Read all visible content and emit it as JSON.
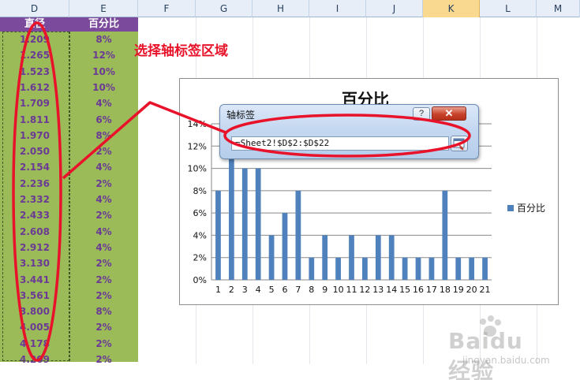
{
  "columns": [
    "D",
    "E",
    "F",
    "G",
    "H",
    "I",
    "J",
    "K",
    "L",
    "M"
  ],
  "selected_column": "K",
  "table": {
    "headers": [
      "直径",
      "百分比"
    ],
    "rows": [
      [
        "1.209",
        "8%"
      ],
      [
        "1.265",
        "12%"
      ],
      [
        "1.523",
        "10%"
      ],
      [
        "1.612",
        "10%"
      ],
      [
        "1.709",
        "4%"
      ],
      [
        "1.811",
        "6%"
      ],
      [
        "1.970",
        "8%"
      ],
      [
        "2.050",
        "2%"
      ],
      [
        "2.154",
        "4%"
      ],
      [
        "2.236",
        "2%"
      ],
      [
        "2.332",
        "4%"
      ],
      [
        "2.433",
        "2%"
      ],
      [
        "2.608",
        "4%"
      ],
      [
        "2.912",
        "4%"
      ],
      [
        "3.130",
        "2%"
      ],
      [
        "3.441",
        "2%"
      ],
      [
        "3.561",
        "2%"
      ],
      [
        "3.800",
        "8%"
      ],
      [
        "4.005",
        "2%"
      ],
      [
        "4.178",
        "2%"
      ],
      [
        "4.209",
        "2%"
      ]
    ]
  },
  "annotation": "选择轴标签区域",
  "dialog": {
    "title": "轴标签",
    "help_label": "?",
    "close_label": "✕",
    "range_value": "=Sheet2!$D$2:$D$22"
  },
  "chart_data": {
    "type": "bar",
    "title": "百分比",
    "categories": [
      "1",
      "2",
      "3",
      "4",
      "5",
      "6",
      "7",
      "8",
      "9",
      "10",
      "11",
      "12",
      "13",
      "14",
      "15",
      "16",
      "17",
      "18",
      "19",
      "20",
      "21"
    ],
    "series": [
      {
        "name": "百分比",
        "values": [
          8,
          12,
          10,
          10,
          4,
          6,
          8,
          2,
          4,
          2,
          4,
          2,
          4,
          4,
          2,
          2,
          2,
          8,
          2,
          2,
          2
        ]
      }
    ],
    "yticks": [
      "0%",
      "2%",
      "4%",
      "6%",
      "8%",
      "10%",
      "12%",
      "14%"
    ],
    "ylim": [
      0,
      14
    ],
    "grid": true,
    "legend": "right",
    "bar_color": "#4f81bd"
  },
  "watermark": {
    "brand": "Baidu经验",
    "sub": "jingyan.baidu.com"
  },
  "colors": {
    "annotation_red": "#e8132a",
    "data_green": "#9bbb59",
    "header_purple": "#7c4a9c",
    "value_text": "#6b3a94"
  }
}
